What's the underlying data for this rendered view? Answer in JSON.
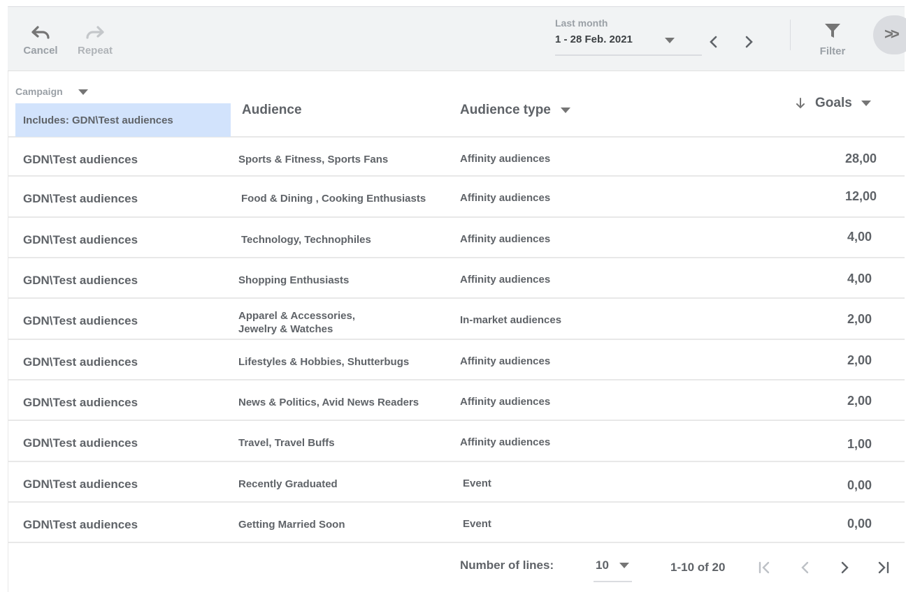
{
  "toolbar": {
    "cancel_label": "Cancel",
    "repeat_label": "Repeat",
    "date_range_label": "Last month",
    "date_range_value": "1 - 28 Feb. 2021",
    "filter_label": "Filter",
    "expand_icon": ">>"
  },
  "table": {
    "campaign_header": "Campaign",
    "campaign_filter": "Includes: GDN\\Test audiences",
    "audience_header": "Audience",
    "audience_type_header": "Audience type",
    "goals_header": "Goals",
    "rows": [
      {
        "campaign": "GDN\\Test audiences",
        "audience": "Sports & Fitness, Sports Fans",
        "audience_line2": "",
        "type": "Affinity audiences",
        "goals": "28,00"
      },
      {
        "campaign": "GDN\\Test audiences",
        "audience": "Food & Dining , Cooking Enthusiasts",
        "audience_line2": "",
        "type": "Affinity audiences",
        "goals": "12,00"
      },
      {
        "campaign": "GDN\\Test audiences",
        "audience": "Technology, Technophiles",
        "audience_line2": "",
        "type": "Affinity audiences",
        "goals": "4,00"
      },
      {
        "campaign": "GDN\\Test audiences",
        "audience": "Shopping Enthusiasts",
        "audience_line2": "",
        "type": "Affinity audiences",
        "goals": "4,00"
      },
      {
        "campaign": "GDN\\Test audiences",
        "audience": "Apparel & Accessories,",
        "audience_line2": "Jewelry & Watches",
        "type": "In-market audiences",
        "goals": "2,00"
      },
      {
        "campaign": "GDN\\Test audiences",
        "audience": "Lifestyles & Hobbies, Shutterbugs",
        "audience_line2": "",
        "type": "Affinity audiences",
        "goals": "2,00"
      },
      {
        "campaign": "GDN\\Test audiences",
        "audience": "News & Politics, Avid News Readers",
        "audience_line2": "",
        "type": "Affinity audiences",
        "goals": "2,00"
      },
      {
        "campaign": "GDN\\Test audiences",
        "audience": "Travel, Travel Buffs",
        "audience_line2": "",
        "type": "Affinity audiences",
        "goals": "1,00"
      },
      {
        "campaign": "GDN\\Test audiences",
        "audience": "Recently Graduated",
        "audience_line2": "",
        "type": "Event",
        "goals": "0,00"
      },
      {
        "campaign": "GDN\\Test audiences",
        "audience": "Getting Married Soon",
        "audience_line2": "",
        "type": "Event",
        "goals": "0,00"
      }
    ]
  },
  "footer": {
    "lines_label": "Number of lines:",
    "lines_value": "10",
    "range_text": "1-10 of 20"
  },
  "colors": {
    "toolbar_bg": "#f1f3f4",
    "filter_chip_bg": "#d2e3fc",
    "text": "#5f6368",
    "muted": "#9aa0a6"
  }
}
